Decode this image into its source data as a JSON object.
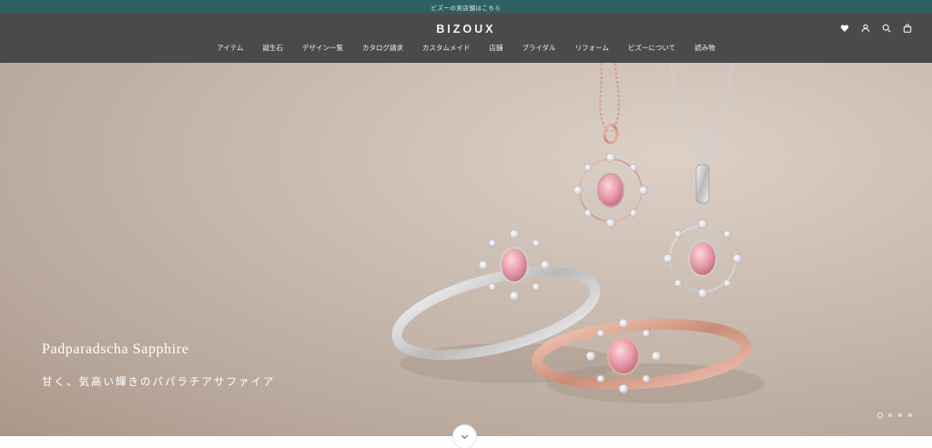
{
  "announcement": {
    "text": "ビズーの実店舗はこちら"
  },
  "header": {
    "logo": "BIZOUX",
    "nav": [
      {
        "label": "アイテム"
      },
      {
        "label": "誕生石"
      },
      {
        "label": "デザイン一覧"
      },
      {
        "label": "カタログ請求"
      },
      {
        "label": "カスタムメイド"
      },
      {
        "label": "店舗"
      },
      {
        "label": "ブライダル"
      },
      {
        "label": "リフォーム"
      },
      {
        "label": "ビズーについて"
      },
      {
        "label": "読み物"
      }
    ],
    "icons": [
      "heart-icon",
      "account-icon",
      "search-icon",
      "cart-icon"
    ]
  },
  "hero": {
    "title": "Padparadscha Sapphire",
    "subtitle": "甘く、気高い輝きのパパラチアサファイア",
    "slides_total": 4,
    "active_slide": 1
  },
  "colors": {
    "announcement_bg": "#2d5f63",
    "header_bg": "#4a4a4a",
    "gem_pink": "#e6a0ad",
    "rose_gold": "#d9a48f",
    "silver": "#d9d9d9"
  }
}
